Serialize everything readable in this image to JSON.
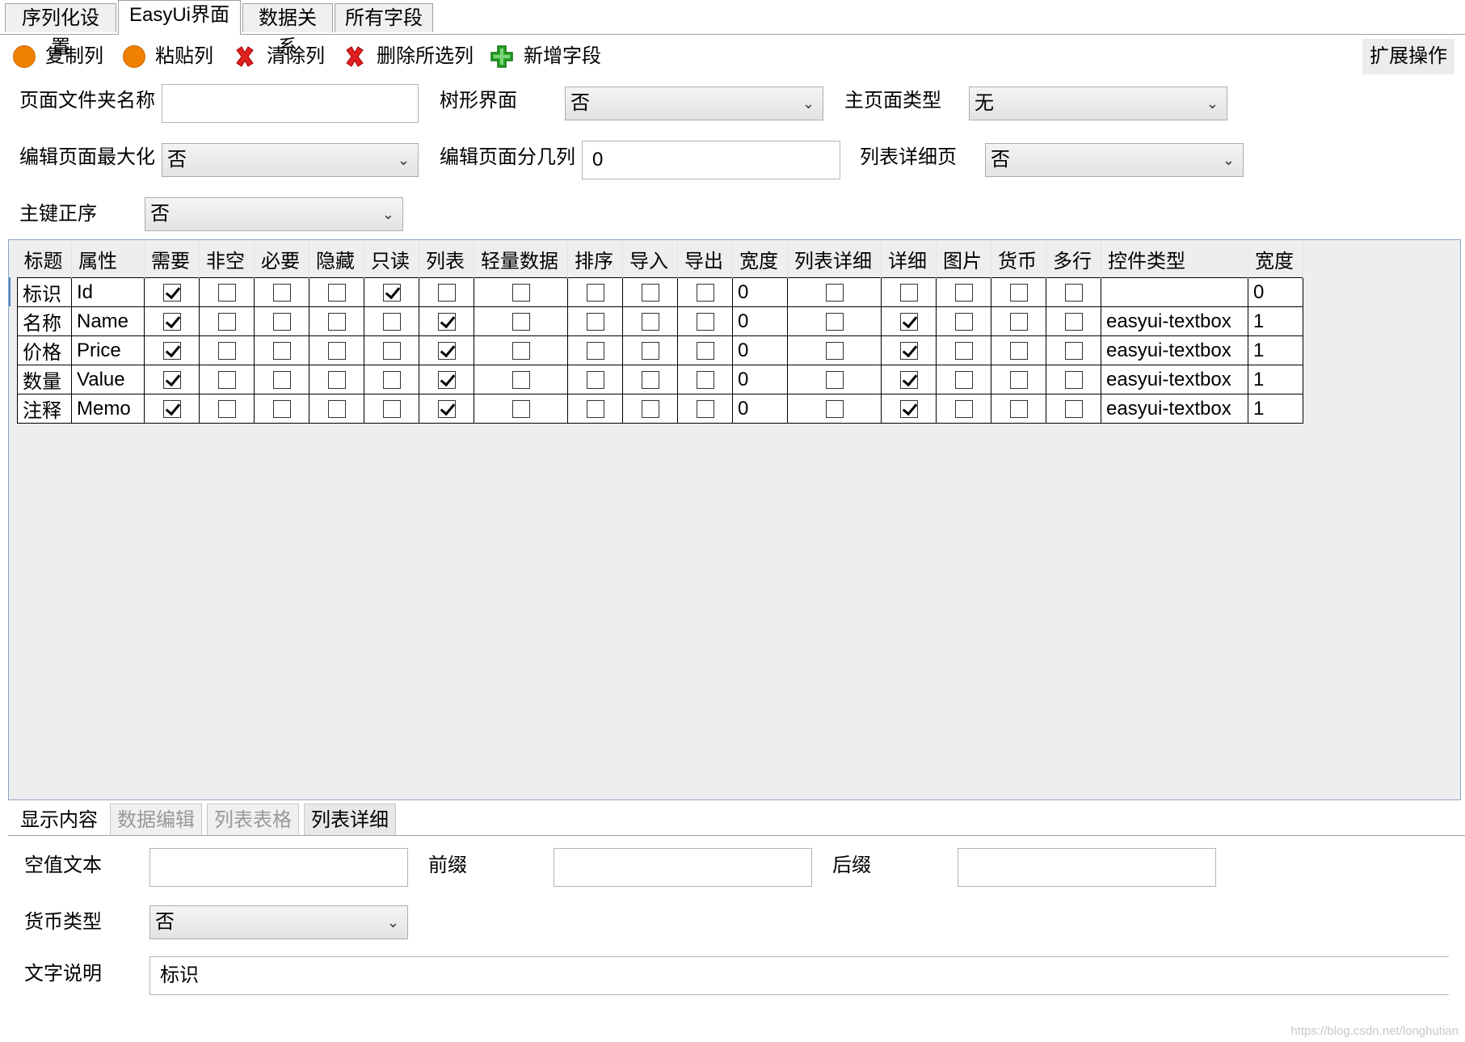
{
  "top_tabs": [
    "序列化设置",
    "EasyUi界面",
    "数据关系",
    "所有字段"
  ],
  "toolbar": {
    "copy_col": "复制列",
    "paste_col": "粘贴列",
    "clear_col": "清除列",
    "delete_selected_col": "删除所选列",
    "add_field": "新增字段",
    "extend_ops": "扩展操作"
  },
  "form": {
    "folder_name_label": "页面文件夹名称",
    "folder_name_value": "",
    "tree_ui_label": "树形界面",
    "tree_ui_value": "否",
    "main_page_type_label": "主页面类型",
    "main_page_type_value": "无",
    "edit_max_label": "编辑页面最大化",
    "edit_max_value": "否",
    "edit_cols_label": "编辑页面分几列",
    "edit_cols_value": "0",
    "list_detail_page_label": "列表详细页",
    "list_detail_page_value": "否",
    "pk_asc_label": "主键正序",
    "pk_asc_value": "否"
  },
  "grid": {
    "columns": [
      "标题",
      "属性",
      "需要",
      "非空",
      "必要",
      "隐藏",
      "只读",
      "列表",
      "轻量数据",
      "排序",
      "导入",
      "导出",
      "宽度",
      "列表详细",
      "详细",
      "图片",
      "货币",
      "多行",
      "控件类型",
      "宽度"
    ],
    "rows": [
      {
        "title": "标识",
        "prop": "Id",
        "need": true,
        "notnull": false,
        "required": false,
        "hidden": false,
        "readonly": true,
        "list": false,
        "light": false,
        "sort": false,
        "import": false,
        "export": false,
        "width": "0",
        "list_detail": false,
        "detail": false,
        "image": false,
        "currency": false,
        "multiline": false,
        "control": "",
        "width2": "0"
      },
      {
        "title": "名称",
        "prop": "Name",
        "need": true,
        "notnull": false,
        "required": false,
        "hidden": false,
        "readonly": false,
        "list": true,
        "light": false,
        "sort": false,
        "import": false,
        "export": false,
        "width": "0",
        "list_detail": false,
        "detail": true,
        "image": false,
        "currency": false,
        "multiline": false,
        "control": "easyui-textbox",
        "width2": "1"
      },
      {
        "title": "价格",
        "prop": "Price",
        "need": true,
        "notnull": false,
        "required": false,
        "hidden": false,
        "readonly": false,
        "list": true,
        "light": false,
        "sort": false,
        "import": false,
        "export": false,
        "width": "0",
        "list_detail": false,
        "detail": true,
        "image": false,
        "currency": false,
        "multiline": false,
        "control": "easyui-textbox",
        "width2": "1"
      },
      {
        "title": "数量",
        "prop": "Value",
        "need": true,
        "notnull": false,
        "required": false,
        "hidden": false,
        "readonly": false,
        "list": true,
        "light": false,
        "sort": false,
        "import": false,
        "export": false,
        "width": "0",
        "list_detail": false,
        "detail": true,
        "image": false,
        "currency": false,
        "multiline": false,
        "control": "easyui-textbox",
        "width2": "1"
      },
      {
        "title": "注释",
        "prop": "Memo",
        "need": true,
        "notnull": false,
        "required": false,
        "hidden": false,
        "readonly": false,
        "list": true,
        "light": false,
        "sort": false,
        "import": false,
        "export": false,
        "width": "0",
        "list_detail": false,
        "detail": true,
        "image": false,
        "currency": false,
        "multiline": false,
        "control": "easyui-textbox",
        "width2": "1"
      }
    ]
  },
  "bottom_tabs": [
    "显示内容",
    "数据编辑",
    "列表表格",
    "列表详细"
  ],
  "bottom": {
    "null_text_label": "空值文本",
    "null_text_value": "",
    "prefix_label": "前缀",
    "prefix_value": "",
    "suffix_label": "后缀",
    "suffix_value": "",
    "currency_type_label": "货币类型",
    "currency_type_value": "否",
    "description_label": "文字说明",
    "description_value": "标识"
  },
  "watermark": "https://blog.csdn.net/longhutian"
}
